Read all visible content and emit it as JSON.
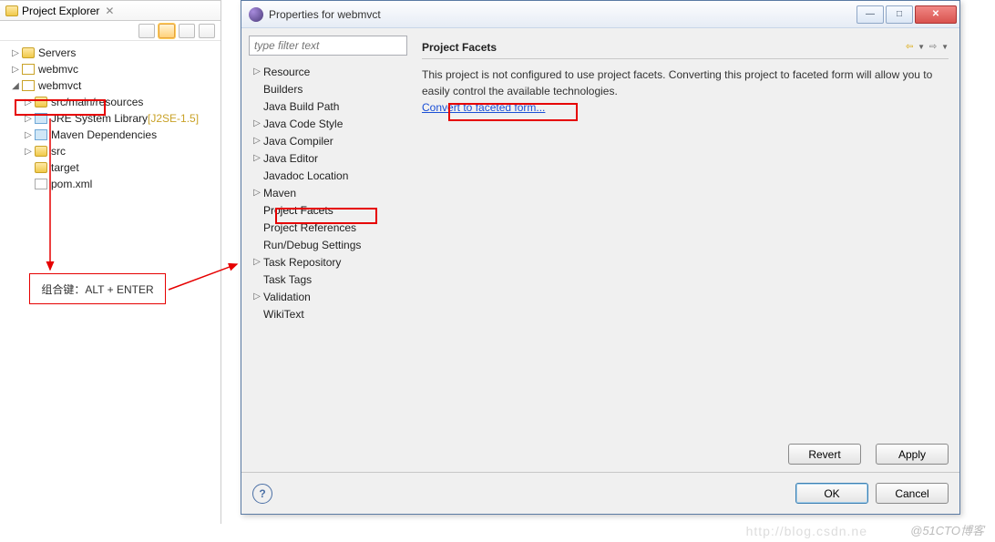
{
  "explorer": {
    "title": "Project Explorer",
    "items": [
      {
        "label": "Servers",
        "arrow": "▷",
        "indent": 0,
        "icon": "folder"
      },
      {
        "label": "webmvc",
        "arrow": "▷",
        "indent": 0,
        "icon": "pkg"
      },
      {
        "label": "webmvct",
        "arrow": "◢",
        "indent": 0,
        "icon": "pkg"
      },
      {
        "label": "src/main/resources",
        "arrow": "▷",
        "indent": 1,
        "icon": "folder"
      },
      {
        "label": "JRE System Library",
        "suffix": " [J2SE-1.5]",
        "arrow": "▷",
        "indent": 1,
        "icon": "jar"
      },
      {
        "label": "Maven Dependencies",
        "arrow": "▷",
        "indent": 1,
        "icon": "jar"
      },
      {
        "label": "src",
        "arrow": "▷",
        "indent": 1,
        "icon": "folder"
      },
      {
        "label": "target",
        "arrow": "",
        "indent": 1,
        "icon": "folder"
      },
      {
        "label": "pom.xml",
        "arrow": "",
        "indent": 1,
        "icon": "file"
      }
    ]
  },
  "hint": "组合键：ALT + ENTER",
  "dialog": {
    "title": "Properties for webmvct",
    "filter_placeholder": "type filter text",
    "nav": [
      {
        "label": "Resource",
        "arrow": "▷"
      },
      {
        "label": "Builders",
        "arrow": ""
      },
      {
        "label": "Java Build Path",
        "arrow": ""
      },
      {
        "label": "Java Code Style",
        "arrow": "▷"
      },
      {
        "label": "Java Compiler",
        "arrow": "▷"
      },
      {
        "label": "Java Editor",
        "arrow": "▷"
      },
      {
        "label": "Javadoc Location",
        "arrow": ""
      },
      {
        "label": "Maven",
        "arrow": "▷"
      },
      {
        "label": "Project Facets",
        "arrow": "",
        "selected": true
      },
      {
        "label": "Project References",
        "arrow": ""
      },
      {
        "label": "Run/Debug Settings",
        "arrow": ""
      },
      {
        "label": "Task Repository",
        "arrow": "▷"
      },
      {
        "label": "Task Tags",
        "arrow": ""
      },
      {
        "label": "Validation",
        "arrow": "▷"
      },
      {
        "label": "WikiText",
        "arrow": ""
      }
    ],
    "section_title": "Project Facets",
    "description": "This project is not configured to use project facets. Converting this project to faceted form will allow you to easily control the available technologies.",
    "convert_link": "Convert to faceted form...",
    "buttons": {
      "revert": "Revert",
      "apply": "Apply",
      "ok": "OK",
      "cancel": "Cancel"
    }
  },
  "watermark": "@51CTO博客",
  "watermark2": "http://blog.csdn.ne"
}
